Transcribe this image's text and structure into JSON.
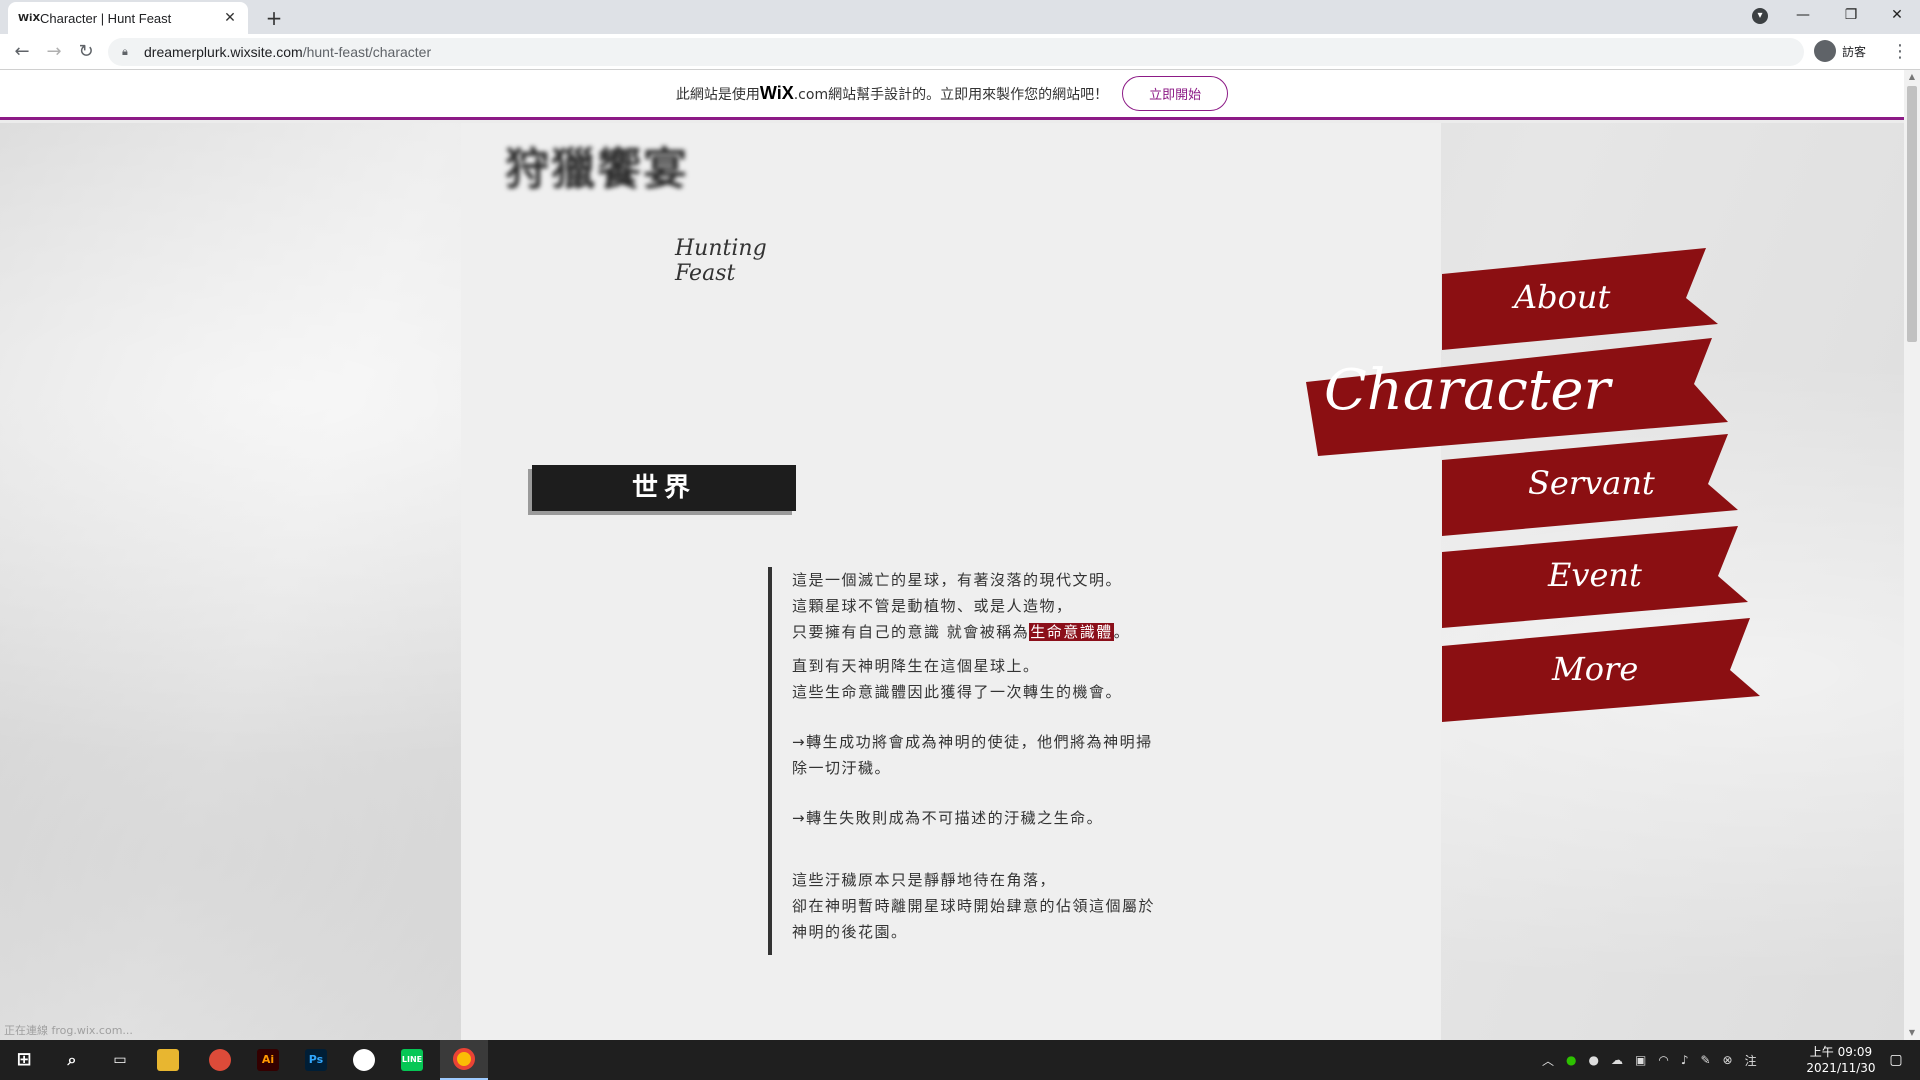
{
  "browser": {
    "tab_title": "Character | Hunt Feast",
    "tab_favicon": "WiX",
    "new_tab_label": "+",
    "url_host": "dreamerplurk.wixsite.com",
    "url_path": "/hunt-feast/character",
    "account_label": "訪客"
  },
  "wix_banner": {
    "text_before": "此網站是使用",
    "logo": "WiX",
    "text_after": ".com網站幫手設計的。立即用來製作您的網站吧！",
    "button": "立即開始"
  },
  "site": {
    "logo_glyphs": "狩獵饗宴",
    "logo_subtitle": "Hunting Feast",
    "section_title": "世界"
  },
  "nav": {
    "items": [
      {
        "label": "About"
      },
      {
        "label": "Character"
      },
      {
        "label": "Servant"
      },
      {
        "label": "Event"
      },
      {
        "label": "More"
      }
    ],
    "ribbon_color": "#8b0f12"
  },
  "story": {
    "p1_line1": "這是一個滅亡的星球，有著沒落的現代文明。",
    "p1_line2": "這顆星球不管是動植物、或是人造物，",
    "p1_line3_before": "只要擁有自己的意識 就會被稱為",
    "p1_line3_highlight": "生命意識體",
    "p1_line3_after": "。",
    "p2_line1": "直到有天神明降生在這個星球上。",
    "p2_line2": "這些生命意識體因此獲得了一次轉生的機會。",
    "p3_line1": "→轉生成功將會成為神明的使徒，他們將為神明掃",
    "p3_line2": "除一切汙穢。",
    "p4_line1": "→轉生失敗則成為不可描述的汙穢之生命。",
    "p5_line1": "這些汙穢原本只是靜靜地待在角落，",
    "p5_line2": "卻在神明暫時離開星球時開始肆意的佔領這個屬於",
    "p5_line3": "神明的後花園。"
  },
  "status_hint": "正在連線 frog.wix.com...",
  "taskbar": {
    "clock_time": "上午 09:09",
    "clock_date": "2021/11/30"
  }
}
